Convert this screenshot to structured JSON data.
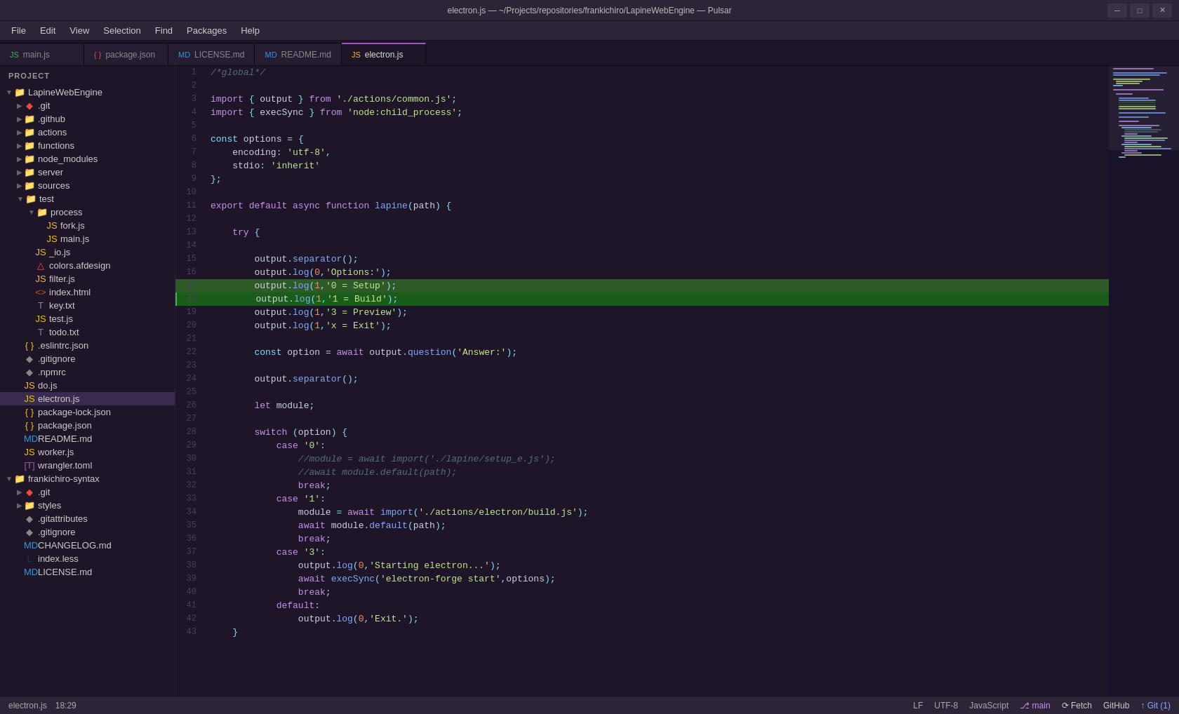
{
  "titlebar": {
    "title": "electron.js — ~/Projects/repositories/frankichiro/LapineWebEngine — Pulsar",
    "controls": [
      "minimize",
      "maximize",
      "close"
    ]
  },
  "menubar": {
    "items": [
      "File",
      "Edit",
      "View",
      "Selection",
      "Find",
      "Packages",
      "Help"
    ]
  },
  "tabs": [
    {
      "id": "main-js",
      "label": "main.js",
      "icon": "js",
      "active": false
    },
    {
      "id": "package-json",
      "label": "package.json",
      "icon": "json",
      "active": false
    },
    {
      "id": "license-md",
      "label": "LICENSE.md",
      "icon": "md",
      "active": false
    },
    {
      "id": "readme-md",
      "label": "README.md",
      "icon": "md",
      "active": false
    },
    {
      "id": "electron-js",
      "label": "electron.js",
      "icon": "js",
      "active": true
    }
  ],
  "sidebar": {
    "title": "Project",
    "tree": [
      {
        "id": "lapinewebengine",
        "label": "LapineWebEngine",
        "indent": 0,
        "type": "folder",
        "open": true
      },
      {
        "id": "git",
        "label": ".git",
        "indent": 1,
        "type": "git-folder",
        "open": false
      },
      {
        "id": "github",
        "label": ".github",
        "indent": 1,
        "type": "folder",
        "open": false
      },
      {
        "id": "actions",
        "label": "actions",
        "indent": 1,
        "type": "folder",
        "open": false
      },
      {
        "id": "functions",
        "label": "functions",
        "indent": 1,
        "type": "folder",
        "open": false
      },
      {
        "id": "node_modules",
        "label": "node_modules",
        "indent": 1,
        "type": "folder",
        "open": false
      },
      {
        "id": "server",
        "label": "server",
        "indent": 1,
        "type": "folder",
        "open": false
      },
      {
        "id": "sources",
        "label": "sources",
        "indent": 1,
        "type": "folder",
        "open": false
      },
      {
        "id": "test",
        "label": "test",
        "indent": 1,
        "type": "folder",
        "open": true
      },
      {
        "id": "process",
        "label": "process",
        "indent": 2,
        "type": "folder",
        "open": true
      },
      {
        "id": "fork-js",
        "label": "fork.js",
        "indent": 3,
        "type": "js"
      },
      {
        "id": "main-js-tree",
        "label": "main.js",
        "indent": 3,
        "type": "js"
      },
      {
        "id": "_io-js",
        "label": "_io.js",
        "indent": 2,
        "type": "js"
      },
      {
        "id": "colors-afdesign",
        "label": "colors.afdesign",
        "indent": 2,
        "type": "afdesign"
      },
      {
        "id": "filter-js",
        "label": "filter.js",
        "indent": 2,
        "type": "js"
      },
      {
        "id": "index-html",
        "label": "index.html",
        "indent": 2,
        "type": "html"
      },
      {
        "id": "key-txt",
        "label": "key.txt",
        "indent": 2,
        "type": "txt"
      },
      {
        "id": "test-js",
        "label": "test.js",
        "indent": 2,
        "type": "js"
      },
      {
        "id": "todo-txt",
        "label": "todo.txt",
        "indent": 2,
        "type": "txt"
      },
      {
        "id": "eslintrc-json",
        "label": ".eslintrc.json",
        "indent": 1,
        "type": "json"
      },
      {
        "id": "gitignore",
        "label": ".gitignore",
        "indent": 1,
        "type": "file"
      },
      {
        "id": "npmrc",
        "label": ".npmrc",
        "indent": 1,
        "type": "file"
      },
      {
        "id": "do-js",
        "label": "do.js",
        "indent": 1,
        "type": "js"
      },
      {
        "id": "electron-js-tree",
        "label": "electron.js",
        "indent": 1,
        "type": "js",
        "active": true
      },
      {
        "id": "package-lock-json",
        "label": "package-lock.json",
        "indent": 1,
        "type": "json"
      },
      {
        "id": "package-json-tree",
        "label": "package.json",
        "indent": 1,
        "type": "json"
      },
      {
        "id": "readme-md-tree",
        "label": "README.md",
        "indent": 1,
        "type": "md"
      },
      {
        "id": "worker-js",
        "label": "worker.js",
        "indent": 1,
        "type": "js"
      },
      {
        "id": "wrangler-toml",
        "label": "wrangler.toml",
        "indent": 1,
        "type": "toml"
      },
      {
        "id": "frankichiro-syntax",
        "label": "frankichiro-syntax",
        "indent": 0,
        "type": "folder",
        "open": true
      },
      {
        "id": "git2",
        "label": ".git",
        "indent": 1,
        "type": "git-folder",
        "open": false
      },
      {
        "id": "styles",
        "label": "styles",
        "indent": 1,
        "type": "folder",
        "open": false
      },
      {
        "id": "gitattributes",
        "label": ".gitattributes",
        "indent": 1,
        "type": "file"
      },
      {
        "id": "gitignore2",
        "label": ".gitignore",
        "indent": 1,
        "type": "file"
      },
      {
        "id": "changelog-md",
        "label": "CHANGELOG.md",
        "indent": 1,
        "type": "md"
      },
      {
        "id": "index-less",
        "label": "index.less",
        "indent": 1,
        "type": "less"
      },
      {
        "id": "license-md-tree",
        "label": "LICENSE.md",
        "indent": 1,
        "type": "md"
      }
    ]
  },
  "editor": {
    "filename": "electron.js",
    "language": "JavaScript",
    "encoding": "UTF-8",
    "line_endings": "LF",
    "cursor": {
      "line": 18,
      "col": 29
    },
    "branch": "main"
  },
  "statusbar": {
    "left": {
      "filename": "electron.js",
      "position": "18:29"
    },
    "right": {
      "line_endings": "LF",
      "encoding": "UTF-8",
      "language": "JavaScript",
      "branch": "⎇  main",
      "fetch": "⟳ Fetch",
      "github": " GitHub",
      "git_count": "↑ Git (1)"
    }
  }
}
